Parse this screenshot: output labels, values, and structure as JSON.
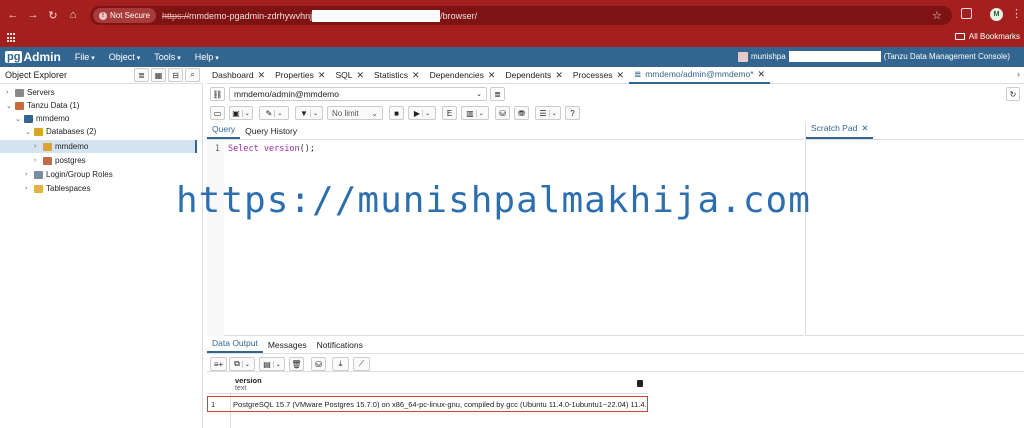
{
  "browser": {
    "security_label": "Not Secure",
    "url_scheme": "https://",
    "url_host": "mmdemo-pgadmin-zdrhywvhnj",
    "url_path": "/browser/",
    "profile_initial": "M",
    "bookmarks_label": "All Bookmarks"
  },
  "app": {
    "logo_pg": "pg",
    "logo_rest": "Admin",
    "menu": [
      "File",
      "Object",
      "Tools",
      "Help"
    ],
    "user_name": "munishpa",
    "user_context": "(Tanzu Data Management Console)"
  },
  "object_explorer": {
    "title": "Object Explorer",
    "tree": [
      {
        "label": "Servers",
        "toggle": "›"
      },
      {
        "label": "Tanzu Data (1)",
        "toggle": "⌄"
      },
      {
        "label": "mmdemo",
        "toggle": "⌄"
      },
      {
        "label": "Databases (2)",
        "toggle": "⌄"
      },
      {
        "label": "mmdemo",
        "toggle": "›"
      },
      {
        "label": "postgres",
        "toggle": "›"
      },
      {
        "label": "Login/Group Roles",
        "toggle": "›"
      },
      {
        "label": "Tablespaces",
        "toggle": "›"
      }
    ]
  },
  "main_tabs": [
    {
      "label": "Dashboard",
      "close": "✕"
    },
    {
      "label": "Properties",
      "close": "✕"
    },
    {
      "label": "SQL",
      "close": "✕"
    },
    {
      "label": "Statistics",
      "close": "✕"
    },
    {
      "label": "Dependencies",
      "close": "✕"
    },
    {
      "label": "Dependents",
      "close": "✕"
    },
    {
      "label": "Processes",
      "close": "✕"
    },
    {
      "label": "mmdemo/admin@mmdemo*",
      "close": "✕"
    }
  ],
  "connection": {
    "value": "mmdemo/admin@mmdemo"
  },
  "toolbar": {
    "limit_label": "No limit"
  },
  "query_tabs": [
    "Query",
    "Query History"
  ],
  "scratch_pad": {
    "label": "Scratch Pad",
    "close": "✕"
  },
  "editor": {
    "line_number": "1",
    "keyword": "Select",
    "function": "version",
    "rest": "();"
  },
  "watermark": "https://munishpalmakhija.com",
  "output_tabs": [
    "Data Output",
    "Messages",
    "Notifications"
  ],
  "grid": {
    "column_name": "version",
    "column_type": "text",
    "rows": [
      {
        "num": "1",
        "value": "PostgreSQL 15.7 (VMware Postgres 15.7.0) on x86_64-pc-linux-gnu, compiled by gcc (Ubuntu 11.4.0-1ubuntu1~22.04) 11.4.0, 6..."
      }
    ]
  }
}
